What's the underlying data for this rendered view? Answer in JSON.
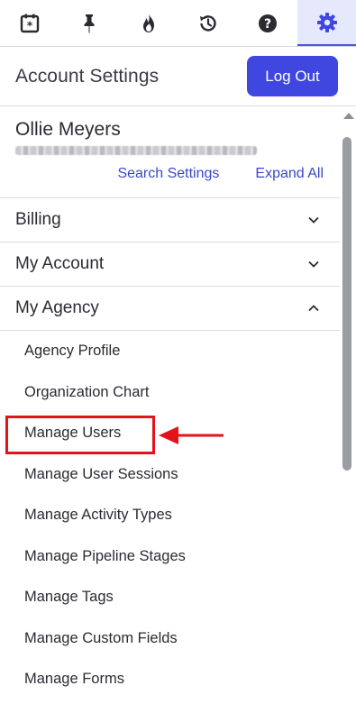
{
  "topbar": {
    "items": [
      {
        "icon": "calendar-star-icon",
        "active": false
      },
      {
        "icon": "pin-icon",
        "active": false
      },
      {
        "icon": "flame-icon",
        "active": false
      },
      {
        "icon": "history-icon",
        "active": false
      },
      {
        "icon": "help-icon",
        "active": false
      },
      {
        "icon": "gear-icon",
        "active": true
      }
    ]
  },
  "header": {
    "title": "Account Settings",
    "logout_label": "Log Out"
  },
  "profile": {
    "name": "Ollie Meyers",
    "search_settings_label": "Search Settings",
    "expand_all_label": "Expand All"
  },
  "sections": {
    "billing": "Billing",
    "my_account": "My Account",
    "my_agency": "My Agency"
  },
  "agency_items": [
    "Agency Profile",
    "Organization Chart",
    "Manage Users",
    "Manage User Sessions",
    "Manage Activity Types",
    "Manage Pipeline Stages",
    "Manage Tags",
    "Manage Custom Fields",
    "Manage Forms"
  ],
  "colors": {
    "accent": "#3f47e0",
    "link": "#3a47c9",
    "active_tab_bg": "#e6e8fb",
    "annotation_red": "#e3131b"
  }
}
